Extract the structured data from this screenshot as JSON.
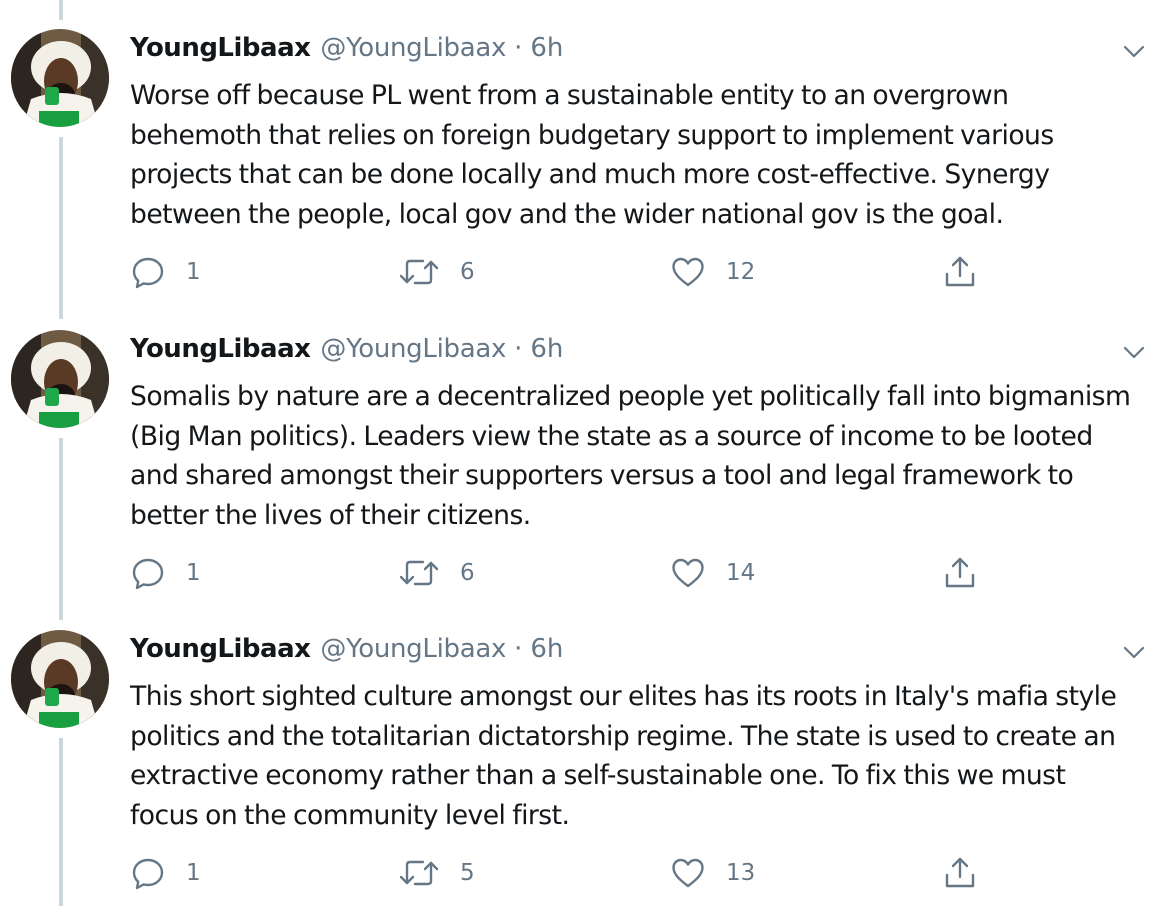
{
  "tweets": [
    {
      "display_name": "YoungLibaax",
      "handle": "@YoungLibaax",
      "separator": "·",
      "time": "6h",
      "text": "Worse off because PL went from a sustainable entity to an overgrown behemoth that relies on foreign budgetary support to implement various projects that can be done locally and much more cost-effective. Synergy between the people, local gov and the wider national gov is the goal.",
      "replies": "1",
      "retweets": "6",
      "likes": "12"
    },
    {
      "display_name": "YoungLibaax",
      "handle": "@YoungLibaax",
      "separator": "·",
      "time": "6h",
      "text": "Somalis by nature are a decentralized people yet politically fall into bigmanism (Big Man politics). Leaders view the state as a source of income to be looted and shared amongst their supporters versus a tool and legal framework to better the lives of their citizens.",
      "replies": "1",
      "retweets": "6",
      "likes": "14"
    },
    {
      "display_name": "YoungLibaax",
      "handle": "@YoungLibaax",
      "separator": "·",
      "time": "6h",
      "text": "This short sighted culture amongst our elites has its roots in Italy's mafia style politics and the totalitarian dictatorship regime. The state is used to create an extractive economy rather than a self-sustainable one. To fix this we must focus on the community level first.",
      "replies": "1",
      "retweets": "5",
      "likes": "13"
    }
  ],
  "icons": {
    "reply": "reply-icon",
    "retweet": "retweet-icon",
    "like": "heart-icon",
    "share": "share-icon",
    "menu": "chevron-down-icon"
  },
  "colors": {
    "thread_line": "#ccd6dd",
    "secondary_text": "#657786",
    "primary_text": "#14171a"
  }
}
